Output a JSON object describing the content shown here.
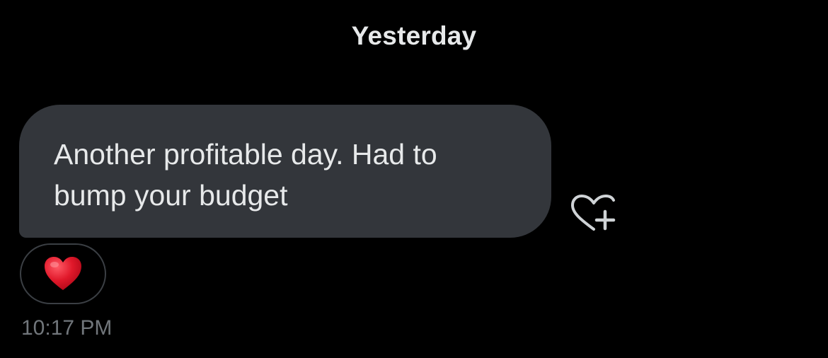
{
  "conversation": {
    "date_separator": "Yesterday",
    "message": {
      "text": "Another profitable day. Had to\nbump your budget",
      "timestamp": "10:17 PM",
      "reaction": {
        "emoji": "red-heart",
        "color": "#e0182a"
      }
    },
    "add_reaction_icon": "heart-plus-icon"
  },
  "colors": {
    "background": "#000000",
    "bubble": "#33363b",
    "text": "#e7e9ea",
    "muted": "#71767b",
    "pill_border": "#3b3f44"
  }
}
